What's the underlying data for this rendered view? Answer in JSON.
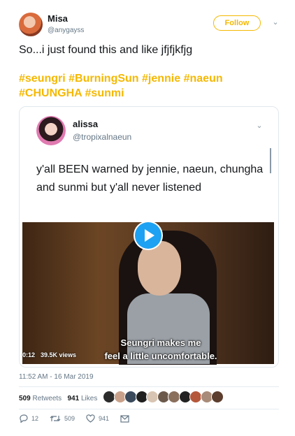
{
  "author": {
    "name": "Misa",
    "handle": "@anygayss"
  },
  "follow_label": "Follow",
  "tweet": {
    "text": "So...i just found this and like jfjfjkfjg",
    "hashtags": "#seungri #BurningSun #jennie #naeun #CHUNGHA #sunmi"
  },
  "quoted": {
    "name": "alissa",
    "handle": "@tropixalnaeun",
    "text": "y'all BEEN warned by jennie, naeun, chungha and sunmi but y'all never listened",
    "video": {
      "subtitle_line1": "Seungri makes me",
      "subtitle_line2": "feel a little uncomfortable.",
      "duration": "0:12",
      "views": "39.5K views"
    }
  },
  "timestamp": "11:52 AM - 16 Mar 2019",
  "stats": {
    "retweets": "509",
    "retweets_label": "Retweets",
    "likes": "941",
    "likes_label": "Likes"
  },
  "actions": {
    "replies": "12",
    "retweets": "509",
    "likes": "941"
  },
  "colors": {
    "accent": "#f5b800",
    "play": "#1da1f2",
    "muted": "#657786"
  },
  "likers": [
    "#2b2b2b",
    "#c9a18a",
    "#3a4a5c",
    "#1f1f1f",
    "#d8c4b2",
    "#6b5a4c",
    "#8a6f5c",
    "#222222",
    "#b5573a",
    "#a88b78",
    "#5c3d2e"
  ]
}
